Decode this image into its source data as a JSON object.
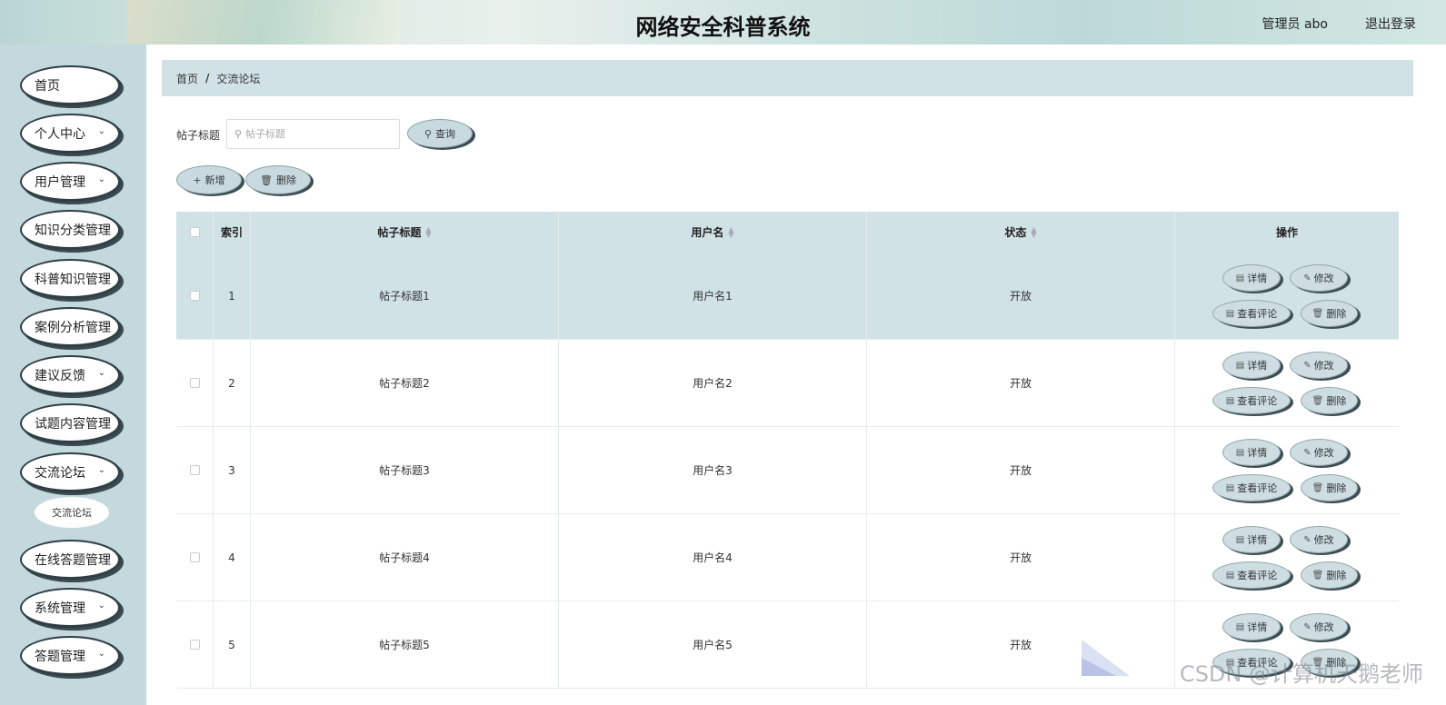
{
  "header": {
    "title": "网络安全科普系统",
    "user": "管理员 abo",
    "logout": "退出登录"
  },
  "sidebar": {
    "items": [
      {
        "label": "首页",
        "expandable": false
      },
      {
        "label": "个人中心",
        "expandable": true
      },
      {
        "label": "用户管理",
        "expandable": true
      },
      {
        "label": "知识分类管理",
        "expandable": false
      },
      {
        "label": "科普知识管理",
        "expandable": false
      },
      {
        "label": "案例分析管理",
        "expandable": false
      },
      {
        "label": "建议反馈",
        "expandable": true
      },
      {
        "label": "试题内容管理",
        "expandable": false
      },
      {
        "label": "交流论坛",
        "expandable": true
      },
      {
        "label": "在线答题管理",
        "expandable": false
      },
      {
        "label": "系统管理",
        "expandable": true
      },
      {
        "label": "答题管理",
        "expandable": true
      }
    ],
    "submenu": {
      "label": "交流论坛"
    }
  },
  "breadcrumb": {
    "home": "首页",
    "sep": "/",
    "current": "交流论坛"
  },
  "search": {
    "label": "帖子标题",
    "placeholder": "帖子标题",
    "button": "查询"
  },
  "toolbar": {
    "add": "新增",
    "delete": "删除"
  },
  "table": {
    "columns": [
      "索引",
      "帖子标题",
      "用户名",
      "状态",
      "操作"
    ],
    "rows": [
      {
        "index": "1",
        "title": "帖子标题1",
        "user": "用户名1",
        "status": "开放"
      },
      {
        "index": "2",
        "title": "帖子标题2",
        "user": "用户名2",
        "status": "开放"
      },
      {
        "index": "3",
        "title": "帖子标题3",
        "user": "用户名3",
        "status": "开放"
      },
      {
        "index": "4",
        "title": "帖子标题4",
        "user": "用户名4",
        "status": "开放"
      },
      {
        "index": "5",
        "title": "帖子标题5",
        "user": "用户名5",
        "status": "开放"
      }
    ],
    "actions": {
      "detail": "详情",
      "edit": "修改",
      "comments": "查看评论",
      "delete": "删除"
    }
  },
  "watermark": "CSDN @计算机天鹅老师",
  "colors": {
    "sidebar_bg": "#c4d9dd",
    "accent": "#d1e2e6",
    "button_shadow": "#3d4d52"
  }
}
